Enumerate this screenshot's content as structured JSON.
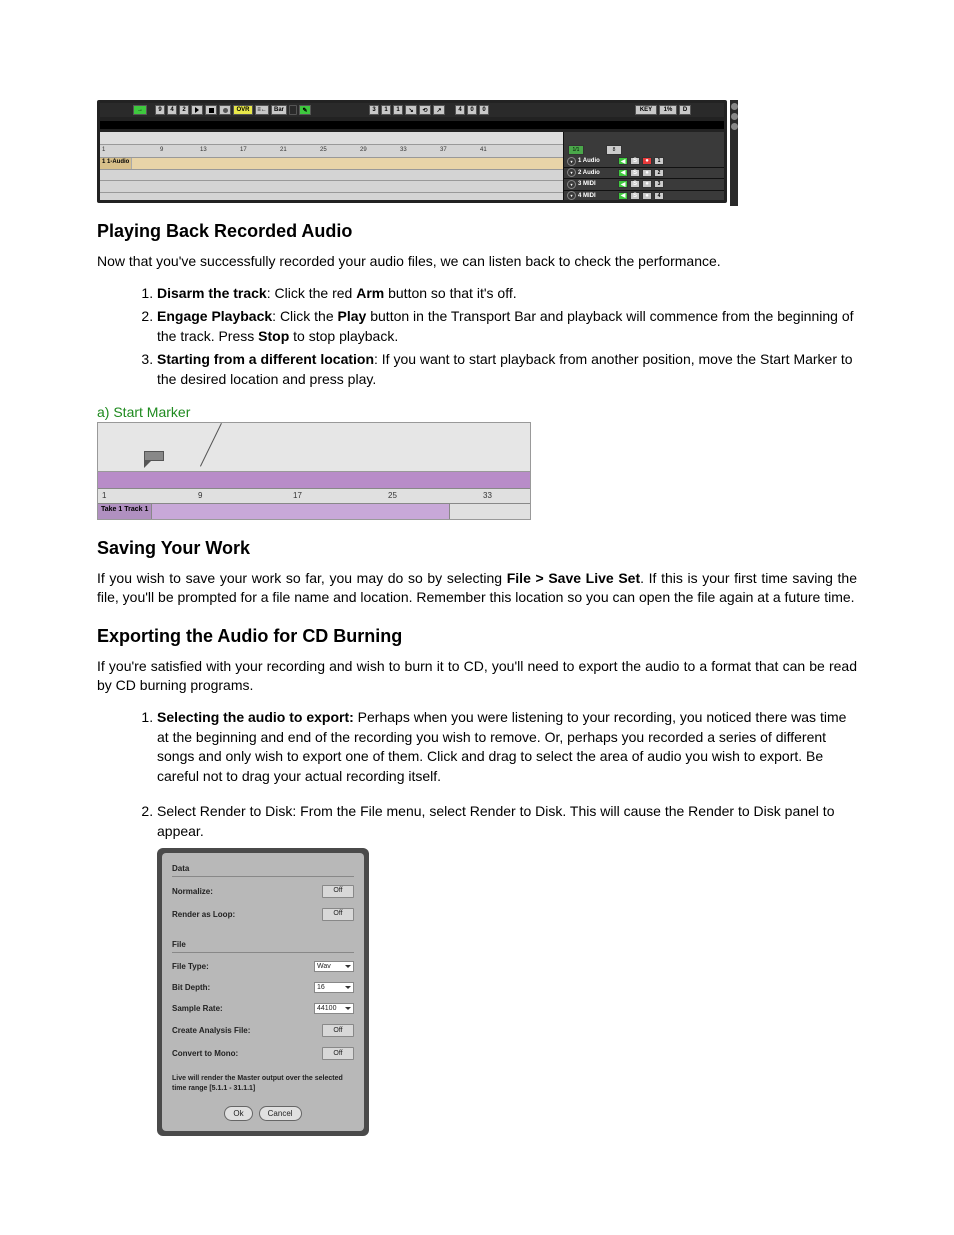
{
  "daw_top": {
    "transport": {
      "time_digits": [
        "9",
        "4",
        "2"
      ],
      "ovr_label": "OVR",
      "bar_label": "Bar",
      "pos_digits": [
        "3",
        "1",
        "1"
      ],
      "tempo_digits": [
        "4",
        "0",
        "0"
      ],
      "key_label": "KEY",
      "pct_label": "1%",
      "right_letter": "D"
    },
    "ruler_ticks": [
      "1",
      "9",
      "13",
      "17",
      "21",
      "25",
      "29",
      "33",
      "37",
      "41"
    ],
    "track1_label": "1 1-Audio",
    "right_ruler": {
      "box1": "1/1",
      "box2": "8"
    },
    "right_tracks": [
      {
        "name": "1 Audio",
        "num": "1"
      },
      {
        "name": "2 Audio",
        "num": "2"
      },
      {
        "name": "3 MIDI",
        "num": "3"
      },
      {
        "name": "4 MIDI",
        "num": "4"
      }
    ]
  },
  "section1": {
    "heading": "Playing Back Recorded Audio",
    "intro": "Now that you've successfully recorded your audio files, we can listen back to check the performance.",
    "items": [
      {
        "bold": "Disarm the track",
        "rest": ": Click the red ",
        "b2": "Arm",
        "rest2": " button so that it's off."
      },
      {
        "bold": "Engage Playback",
        "rest": ": Click the ",
        "b2": "Play",
        "rest2": " button in the Transport Bar and playback will commence from the beginning of the track. Press ",
        "b3": "Stop",
        "rest3": " to stop playback."
      },
      {
        "bold": "Starting from a different location",
        "rest": ": If you want to start playback from another position, move the Start Marker to the desired location and press play."
      }
    ]
  },
  "start_marker": {
    "label": "a) Start Marker",
    "ticks": [
      "1",
      "9",
      "17",
      "25",
      "33"
    ],
    "band_label": "Take 1 Track 1"
  },
  "section2": {
    "heading": "Saving Your Work",
    "para_parts": {
      "a": "If you wish to save your work so far, you may do so by selecting ",
      "b": "File > Save Live Set",
      "c": ". If this is your first time saving the file, you'll be prompted for a file name and location. Remember this location so you can open the file again at a future time."
    }
  },
  "section3": {
    "heading": "Exporting the Audio for CD Burning",
    "intro": "If you're satisfied with your recording and wish to burn it to CD, you'll need to export the audio to a format that can be read by CD burning programs.",
    "items": [
      {
        "bold": "Selecting the audio to export:",
        "rest": " Perhaps when you were listening to your recording, you noticed there was time at the beginning and end of the recording you wish to remove. Or, perhaps you recorded a series of different songs and only wish to export one of them. Click and drag to select the area of audio you wish to export. Be careful not to drag your actual recording itself."
      },
      {
        "rest": "Select Render to Disk: From the File menu, select Render to Disk. This will cause the Render to Disk panel to appear."
      }
    ]
  },
  "render_dialog": {
    "sections": {
      "data_hdr": "Data",
      "file_hdr": "File"
    },
    "rows": {
      "normalize": {
        "label": "Normalize:",
        "value": "Off"
      },
      "loop": {
        "label": "Render as Loop:",
        "value": "Off"
      },
      "filetype": {
        "label": "File Type:",
        "value": "Wav"
      },
      "bitdepth": {
        "label": "Bit Depth:",
        "value": "16"
      },
      "samplerate": {
        "label": "Sample Rate:",
        "value": "44100"
      },
      "analysis": {
        "label": "Create Analysis File:",
        "value": "Off"
      },
      "mono": {
        "label": "Convert to Mono:",
        "value": "Off"
      }
    },
    "note_line1": "Live will render the Master output over the selected",
    "note_line2": "time range [5.1.1 - 31.1.1]",
    "btn_ok": "Ok",
    "btn_cancel": "Cancel"
  }
}
